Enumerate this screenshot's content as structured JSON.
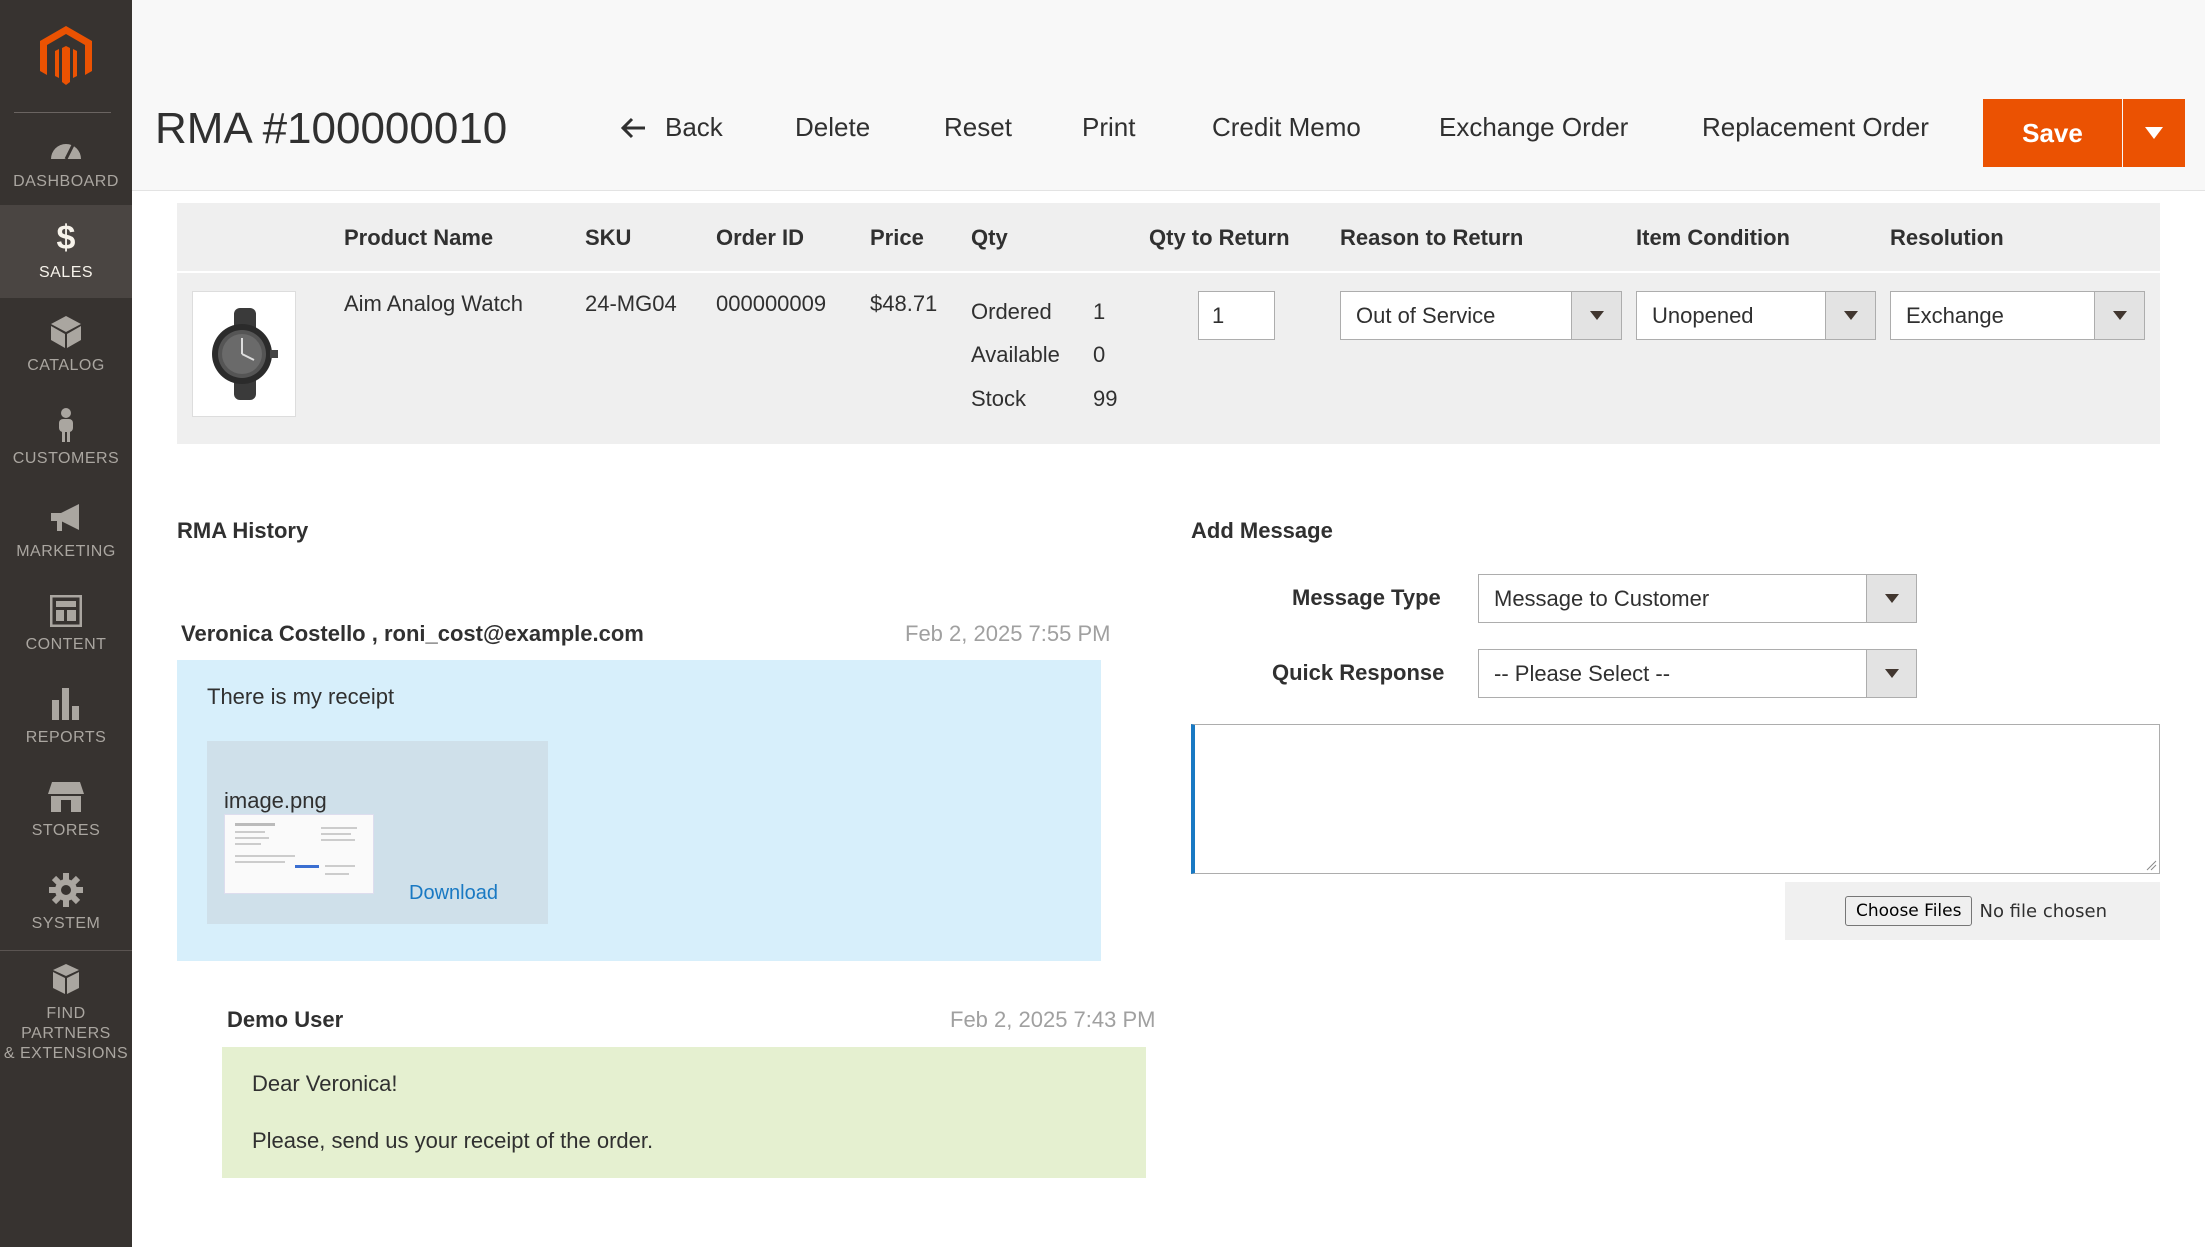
{
  "sidebar": {
    "items": [
      {
        "label": "DASHBOARD",
        "icon": "dashboard-icon"
      },
      {
        "label": "SALES",
        "icon": "dollar-icon"
      },
      {
        "label": "CATALOG",
        "icon": "cube-icon"
      },
      {
        "label": "CUSTOMERS",
        "icon": "person-icon"
      },
      {
        "label": "MARKETING",
        "icon": "megaphone-icon"
      },
      {
        "label": "CONTENT",
        "icon": "layout-icon"
      },
      {
        "label": "REPORTS",
        "icon": "bar-chart-icon"
      },
      {
        "label": "STORES",
        "icon": "storefront-icon"
      },
      {
        "label": "SYSTEM",
        "icon": "gear-icon"
      },
      {
        "label": "FIND PARTNERS\n& EXTENSIONS",
        "icon": "boxes-icon"
      }
    ],
    "find_partners_line1": "FIND PARTNERS",
    "find_partners_line2": "& EXTENSIONS",
    "active": "SALES"
  },
  "header": {
    "title": "RMA #100000010",
    "back": "Back",
    "delete": "Delete",
    "reset": "Reset",
    "print": "Print",
    "credit_memo": "Credit Memo",
    "exchange_order": "Exchange Order",
    "replacement_order": "Replacement Order",
    "save": "Save"
  },
  "items_table": {
    "columns": [
      "Product Name",
      "SKU",
      "Order ID",
      "Price",
      "Qty",
      "Qty to Return",
      "Reason to Return",
      "Item Condition",
      "Resolution"
    ],
    "row": {
      "product_name": "Aim Analog Watch",
      "sku": "24-MG04",
      "order_id": "000000009",
      "price": "$48.71",
      "qty": [
        {
          "label": "Ordered",
          "value": "1"
        },
        {
          "label": "Available",
          "value": "0"
        },
        {
          "label": "Stock",
          "value": "99"
        }
      ],
      "qty_to_return": "1",
      "reason": "Out of Service",
      "condition": "Unopened",
      "resolution": "Exchange"
    }
  },
  "history": {
    "title": "RMA History",
    "messages": [
      {
        "author": "Veronica Costello , roni_cost@example.com",
        "date": "Feb 2, 2025 7:55 PM",
        "text": "There is my receipt",
        "attachment": {
          "name": "image.png",
          "download": "Download"
        }
      },
      {
        "author": "Demo User",
        "date": "Feb 2, 2025 7:43 PM",
        "line1": "Dear Veronica!",
        "line2": "Please, send us your receipt of the order."
      }
    ]
  },
  "add_message": {
    "title": "Add Message",
    "message_type_label": "Message Type",
    "message_type_value": "Message to Customer",
    "quick_response_label": "Quick Response",
    "quick_response_value": "-- Please Select --",
    "choose_files": "Choose Files",
    "no_file": "No file chosen"
  },
  "colors": {
    "sidebar_bg": "#373330",
    "accent": "#eb5202",
    "link": "#1979c3",
    "customer_bubble": "#d7effb",
    "admin_bubble": "#e5f0d0"
  }
}
